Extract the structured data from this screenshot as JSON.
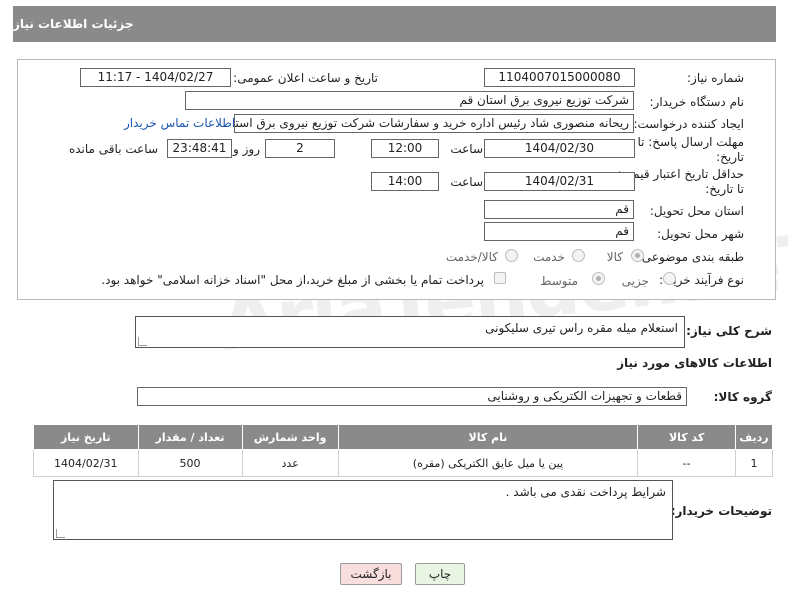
{
  "header": {
    "title": "جزئیات اطلاعات نیاز"
  },
  "form": {
    "need_number": {
      "label": "شماره نیاز:",
      "value": "1104007015000080"
    },
    "announce_datetime": {
      "label": "تاریخ و ساعت اعلان عمومی:",
      "value": "1404/02/27 - 11:17"
    },
    "buyer_org": {
      "label": "نام دستگاه خریدار:",
      "value": "شرکت توزیع نیروی برق استان قم"
    },
    "requester": {
      "label": "ایجاد کننده درخواست:",
      "value": "ریحانه منصوری شاد رئیس اداره خرید و سفارشات شرکت توزیع نیروی برق استان قم",
      "link": "اطلاعات تماس خریدار"
    },
    "reply_deadline": {
      "label_line1": "مهلت ارسال پاسخ: تا",
      "label_line2": "تاریخ:",
      "date": "1404/02/30",
      "time_label": "ساعت",
      "time": "12:00",
      "days": "2",
      "days_label": "روز و",
      "remaining": "23:48:41",
      "remaining_label": "ساعت باقی مانده"
    },
    "price_validity": {
      "label_line1": "حداقل تاریخ اعتبار قیمت:",
      "label_line2": "تا تاریخ:",
      "date": "1404/02/31",
      "time_label": "ساعت",
      "time": "14:00"
    },
    "delivery_province": {
      "label": "استان محل تحویل:",
      "value": "قم"
    },
    "delivery_city": {
      "label": "شهر محل تحویل:",
      "value": "قم"
    },
    "category": {
      "label": "طبقه بندی موضوعی:",
      "options": [
        "کالا",
        "خدمت",
        "کالا/خدمت"
      ],
      "selected": "کالا"
    },
    "purchase_type": {
      "label": "نوع فرآیند خرید :",
      "options": [
        "جزیی",
        "متوسط"
      ],
      "selected": "متوسط",
      "payment_note": "پرداخت تمام یا بخشی از مبلغ خرید،از محل \"اسناد خزانه اسلامی\" خواهد بود."
    }
  },
  "summary": {
    "label": "شرح کلی نیاز:",
    "value": "استعلام میله مقره راس تیری سلیکونی"
  },
  "goods_section": {
    "title": "اطلاعات کالاهای مورد نیاز"
  },
  "goods_group": {
    "label": "گروه کالا:",
    "value": "قطعات و تجهیزات الکتریکی و روشنایی"
  },
  "table": {
    "columns": [
      "ردیف",
      "کد کالا",
      "نام کالا",
      "واحد شمارش",
      "تعداد / مقدار",
      "تاریخ نیاز"
    ],
    "rows": [
      [
        "1",
        "--",
        "پین یا میل عایق الکتریکی (مقره)",
        "عدد",
        "500",
        "1404/02/31"
      ]
    ]
  },
  "buyer_notes": {
    "label": "توضیحات خریدار:",
    "value": "شرایط پرداخت نقدی می باشد ."
  },
  "buttons": {
    "print": "چاپ",
    "back": "بازگشت"
  },
  "colors": {
    "header_bg": "#8a8a8a",
    "link": "#1a56b0",
    "back_button_bg": "#f9dede",
    "print_button_bg": "#e8f5e2"
  },
  "watermark": "AriaTender.neT"
}
